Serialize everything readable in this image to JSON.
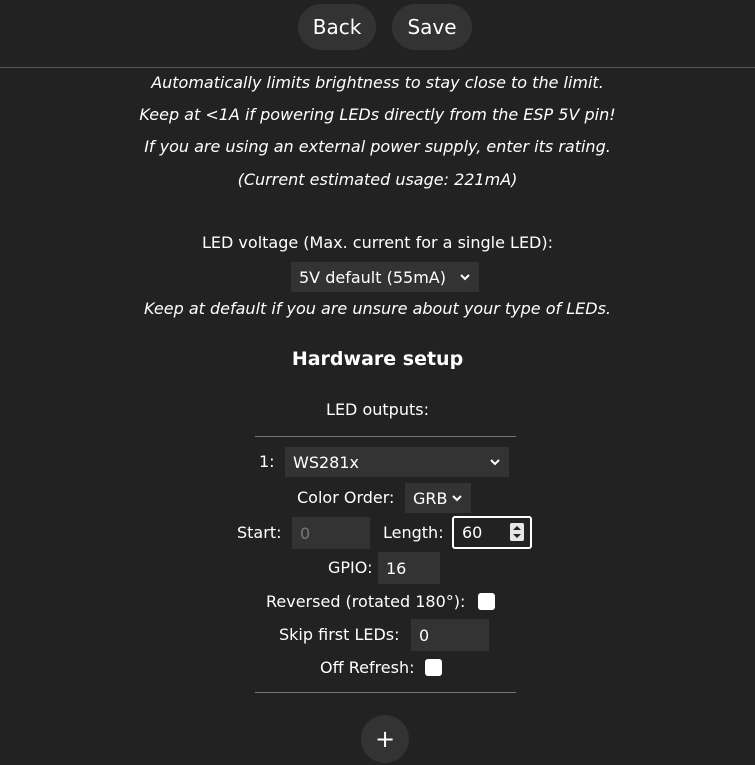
{
  "toolbar": {
    "back_label": "Back",
    "save_label": "Save"
  },
  "power": {
    "line1": "Automatically limits brightness to stay close to the limit.",
    "line2": "Keep at <1A if powering LEDs directly from the ESP 5V pin!",
    "line3": "If you are using an external power supply, enter its rating.",
    "line4": "(Current estimated usage: 221mA)"
  },
  "voltage": {
    "label": "LED voltage (Max. current for a single LED):",
    "selected": "5V default (55mA)",
    "hint": "Keep at default if you are unsure about your type of LEDs."
  },
  "hardware": {
    "heading": "Hardware setup",
    "outputs_label": "LED outputs:",
    "output": {
      "index_label": "1:",
      "type_selected": "WS281x",
      "color_order_label": "Color Order:",
      "color_order_selected": "GRB",
      "start_label": "Start:",
      "start_value": "0",
      "length_label": "Length:",
      "length_value": "60",
      "gpio_label": "GPIO:",
      "gpio_value": "16",
      "reversed_label": "Reversed (rotated 180°):",
      "reversed_checked": false,
      "skip_label": "Skip first LEDs:",
      "skip_value": "0",
      "off_refresh_label": "Off Refresh:",
      "off_refresh_checked": false
    },
    "add_label": "+"
  }
}
